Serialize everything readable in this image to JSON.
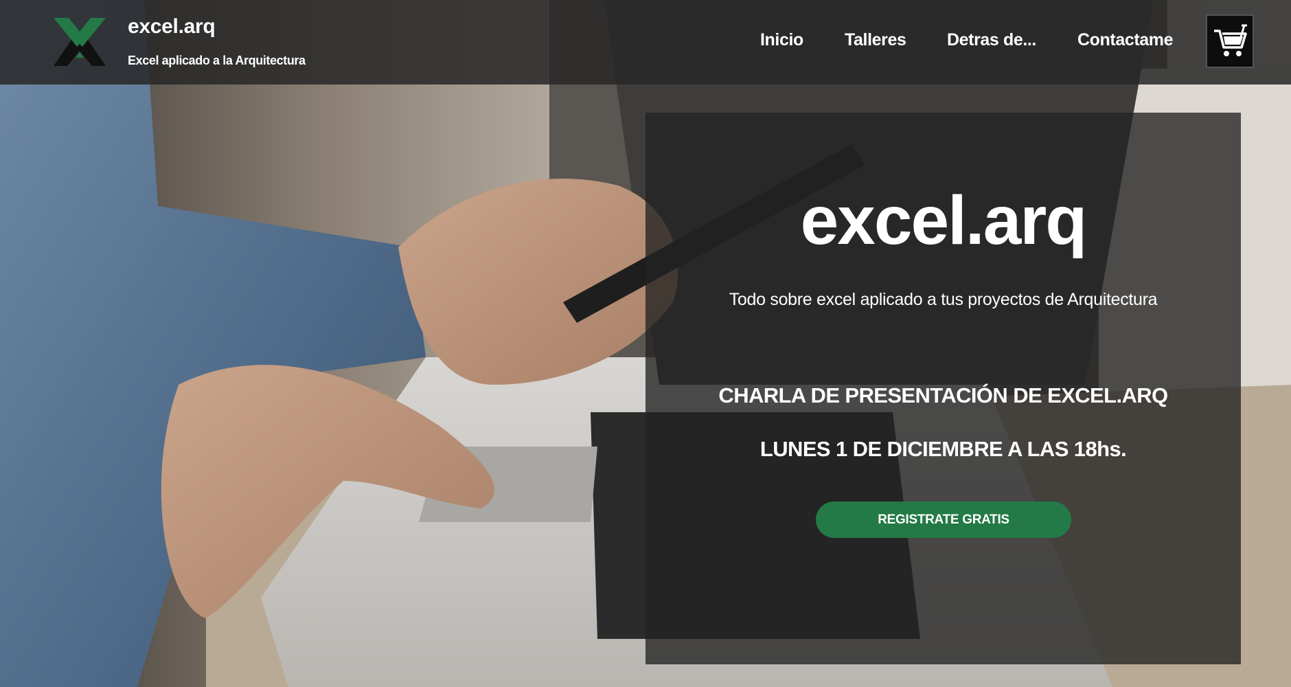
{
  "header": {
    "site_title": "excel.arq",
    "tagline": "Excel aplicado a la Arquitectura",
    "logo_icon": "excel-arq-logo-icon",
    "brand_color": "#237a46"
  },
  "nav": {
    "items": [
      {
        "label": "Inicio"
      },
      {
        "label": "Talleres"
      },
      {
        "label": "Detras de..."
      },
      {
        "label": "Contactame"
      }
    ],
    "cart_icon": "shopping-cart-icon"
  },
  "hero": {
    "title": "excel.arq",
    "subtitle": "Todo sobre excel aplicado a tus proyectos de Arquitectura",
    "event_title": "CHARLA DE PRESENTACIÓN DE EXCEL.ARQ",
    "event_date": "LUNES 1 DE DICIEMBRE A LAS 18hs.",
    "cta_label": "REGISTRATE GRATIS",
    "cta_color": "#237a46"
  }
}
